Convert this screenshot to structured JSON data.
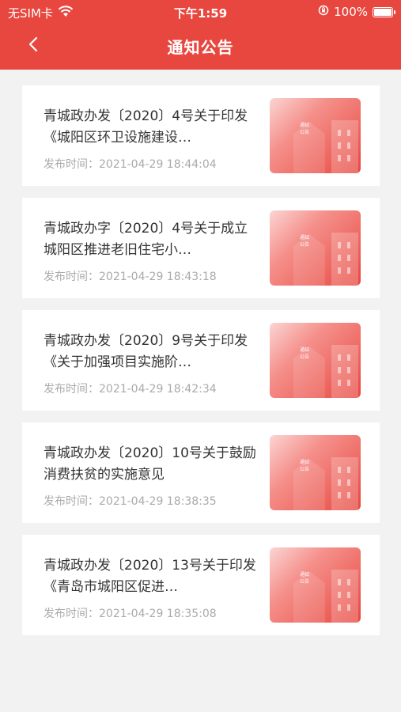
{
  "status_bar": {
    "carrier": "无SIM卡",
    "time": "下午1:59",
    "battery": "100%"
  },
  "nav": {
    "title": "通知公告",
    "back_icon": "chevron-left-icon"
  },
  "time_prefix": "发布时间：",
  "thumb_label": [
    "通知",
    "公告"
  ],
  "colors": {
    "brand": "#e8473f",
    "background": "#f2f2f2"
  },
  "notices": [
    {
      "title": "青城政办发〔2020〕4号关于印发《城阳区环卫设施建设…",
      "time": "2021-04-29 18:44:04"
    },
    {
      "title": "青城政办字〔2020〕4号关于成立城阳区推进老旧住宅小…",
      "time": "2021-04-29 18:43:18"
    },
    {
      "title": "青城政办发〔2020〕9号关于印发《关于加强项目实施阶…",
      "time": "2021-04-29 18:42:34"
    },
    {
      "title": "青城政办发〔2020〕10号关于鼓励消费扶贫的实施意见",
      "time": "2021-04-29 18:38:35"
    },
    {
      "title": "青城政办发〔2020〕13号关于印发《青岛市城阳区促进…",
      "time": "2021-04-29 18:35:08"
    }
  ]
}
